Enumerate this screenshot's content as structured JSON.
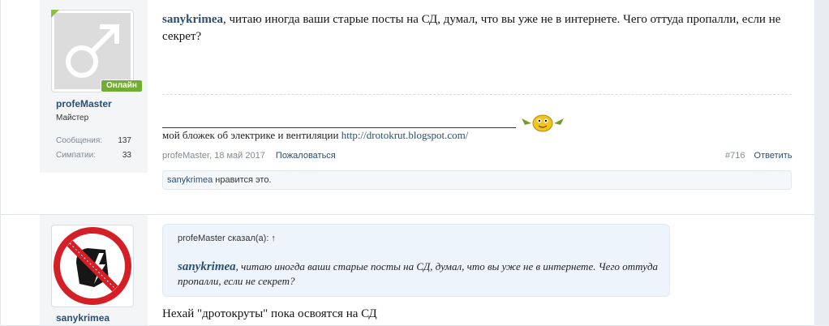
{
  "post1": {
    "username": "profeMaster",
    "role": "Майстер",
    "online_badge": "Онлайн",
    "stats": [
      {
        "label": "Сообщения:",
        "value": "137"
      },
      {
        "label": "Симпатии:",
        "value": "33"
      }
    ],
    "message_mention": "sanykrimea",
    "message_rest": ", читаю иногда ваши старые посты на СД, думал, что вы уже не в интернете. Чего оттуда пропалли, если не секрет?",
    "signature_text": "мой бложек об электрике и вентиляции ",
    "signature_link": "http://drotokrut.blogspot.com/",
    "meta_author_date": "profeMaster, 18 май 2017",
    "report_link": "Пожаловаться",
    "post_number": "#716",
    "reply_link": "Ответить",
    "likes_user": "sanykrimea",
    "likes_text": " нравится это."
  },
  "post2": {
    "username": "sanykrimea",
    "quote_header": "profeMaster сказал(а): ↑",
    "quote_mention": "sanykrimea",
    "quote_rest": ", читаю иногда ваши старые посты на СД, думал, что вы уже не в интернете. Чего оттуда пропалли, если не секрет?",
    "reply_text": "Нехай \"дротокруты\" пока освоятся на СД"
  },
  "colors": {
    "link": "#2b4e72",
    "online": "#6fae31",
    "quote_bg": "#eef4fc",
    "sidebar_bg": "#f3f5f7"
  }
}
